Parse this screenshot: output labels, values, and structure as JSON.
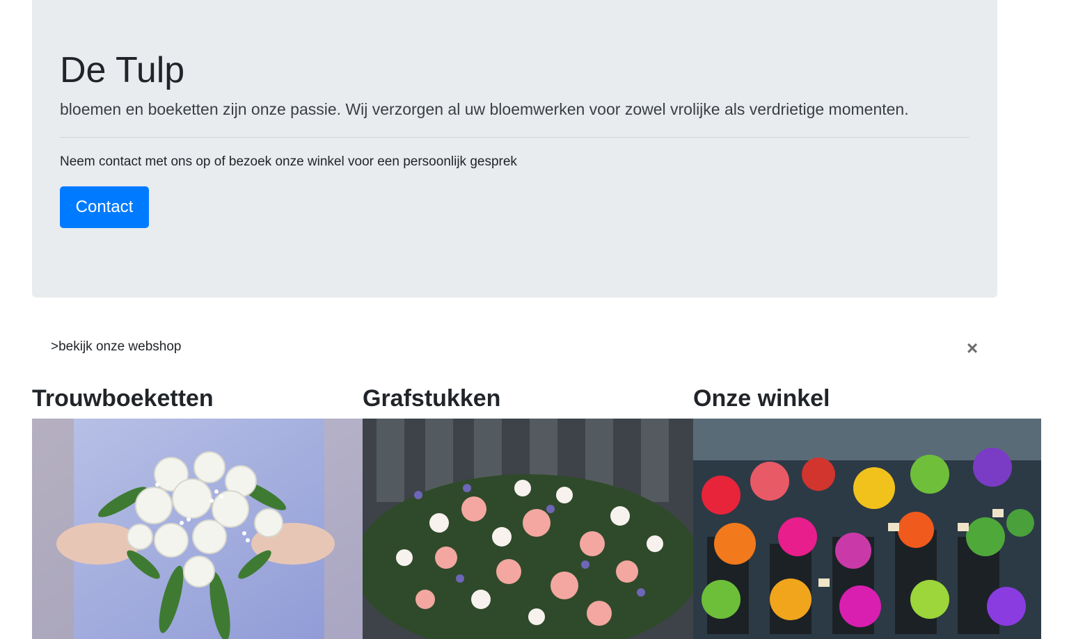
{
  "hero": {
    "title": "De Tulp",
    "lead": "bloemen en boeketten zijn onze passie. Wij verzorgen al uw bloemwerken voor zowel vrolijke als verdrietige momenten.",
    "subtext": "Neem contact met ons op of bezoek onze winkel voor een persoonlijk gesprek",
    "button_label": "Contact"
  },
  "alert": {
    "text": ">bekijk onze webshop",
    "close_icon": "close-icon",
    "close_glyph": "×"
  },
  "cards": [
    {
      "title": "Trouwboeketten",
      "image": "wedding-bouquet-photo"
    },
    {
      "title": "Grafstukken",
      "image": "funeral-arrangement-photo"
    },
    {
      "title": "Onze winkel",
      "image": "flower-shop-photo"
    }
  ],
  "colors": {
    "primary": "#007bff",
    "jumbotron_bg": "#e9ecef",
    "text": "#212529"
  }
}
